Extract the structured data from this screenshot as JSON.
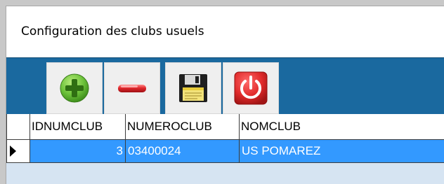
{
  "window": {
    "title": "Configuration des clubs usuels"
  },
  "toolbar": {
    "buttons": [
      {
        "name": "add-button",
        "icon": "plus-circle-icon",
        "color": "#6cc23a"
      },
      {
        "name": "remove-button",
        "icon": "minus-icon",
        "color": "#e0262b"
      },
      {
        "name": "save-button",
        "icon": "floppy-disk-icon",
        "color": "#f2c830"
      },
      {
        "name": "power-button",
        "icon": "power-icon",
        "color": "#e02a2a"
      }
    ],
    "background": "#1a699f"
  },
  "grid": {
    "columns": [
      "IDNUMCLUB",
      "NUMEROCLUB",
      "NOMCLUB"
    ],
    "rows": [
      {
        "id": "3",
        "numero": "03400024",
        "nom": "US POMAREZ",
        "selected": true
      }
    ],
    "selection_color": "#3399ff"
  }
}
